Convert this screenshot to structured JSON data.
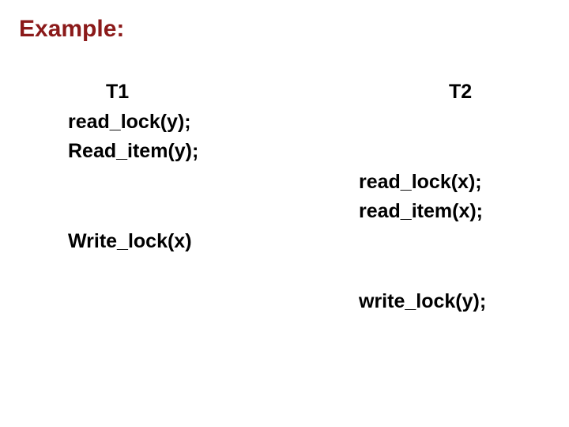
{
  "title": "Example:",
  "t1": {
    "header": "T1",
    "lines": {
      "l0": "read_lock(y);",
      "l1": "Read_item(y);",
      "l2": "Write_lock(x)"
    }
  },
  "t2": {
    "header": "T2",
    "lines": {
      "l0": "read_lock(x);",
      "l1": "read_item(x);",
      "l2": "write_lock(y);"
    }
  }
}
